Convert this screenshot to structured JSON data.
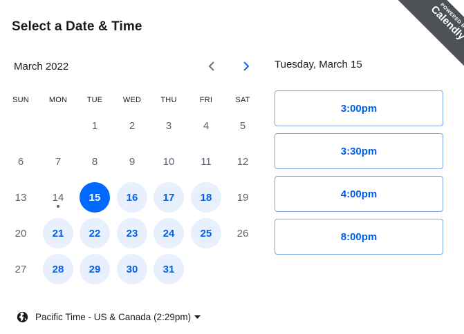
{
  "header": {
    "title": "Select a Date & Time"
  },
  "ribbon": {
    "powered_by": "POWERED BY",
    "brand": "Calendly"
  },
  "calendar": {
    "month_label": "March 2022",
    "weekdays": [
      "SUN",
      "MON",
      "TUE",
      "WED",
      "THU",
      "FRI",
      "SAT"
    ],
    "weeks": [
      [
        null,
        null,
        "1",
        "2",
        "3",
        "4",
        "5"
      ],
      [
        "6",
        "7",
        "8",
        "9",
        "10",
        "11",
        "12"
      ],
      [
        "13",
        "14",
        "15",
        "16",
        "17",
        "18",
        "19"
      ],
      [
        "20",
        "21",
        "22",
        "23",
        "24",
        "25",
        "26"
      ],
      [
        "27",
        "28",
        "29",
        "30",
        "31",
        null,
        null
      ]
    ],
    "available": [
      "15",
      "16",
      "17",
      "18",
      "21",
      "22",
      "23",
      "24",
      "25",
      "28",
      "29",
      "30",
      "31"
    ],
    "selected": "15",
    "today": "14"
  },
  "times": {
    "date_heading": "Tuesday, March 15",
    "slots": [
      "3:00pm",
      "3:30pm",
      "4:00pm",
      "8:00pm"
    ]
  },
  "timezone": {
    "label": "Pacific Time - US & Canada (2:29pm)"
  },
  "colors": {
    "accent": "#0069ff",
    "available_bg": "#e8f0fd",
    "text_muted": "#5c6470"
  }
}
